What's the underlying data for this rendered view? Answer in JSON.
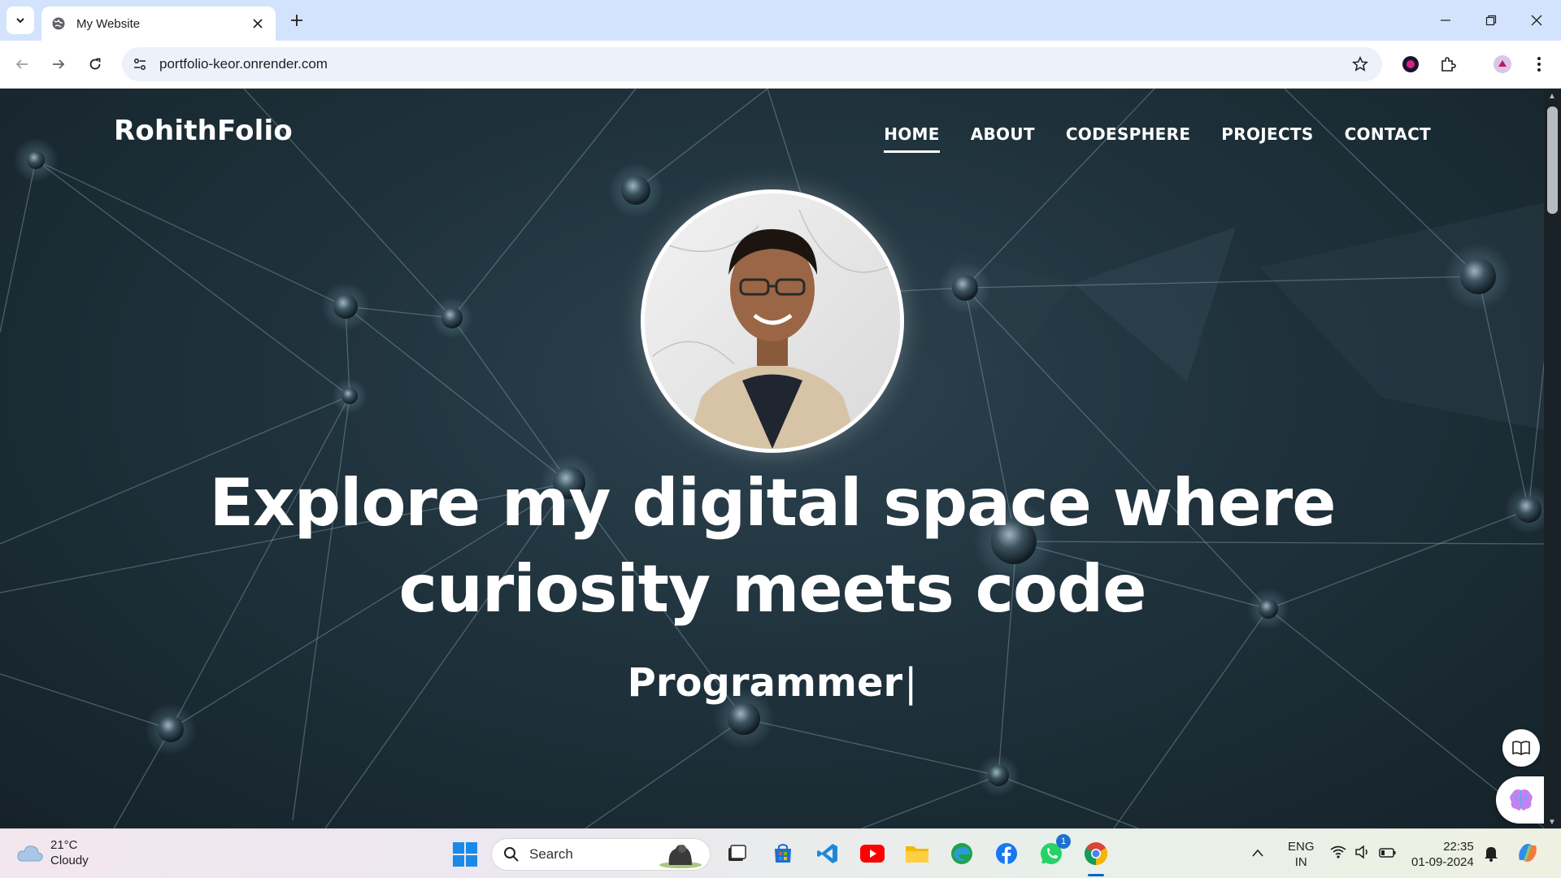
{
  "browser": {
    "tab_title": "My Website",
    "url": "portfolio-keor.onrender.com"
  },
  "site": {
    "logo": "RohithFolio",
    "nav": [
      {
        "label": "HOME",
        "active": true
      },
      {
        "label": "ABOUT",
        "active": false
      },
      {
        "label": "CODESPHERE",
        "active": false
      },
      {
        "label": "PROJECTS",
        "active": false
      },
      {
        "label": "CONTACT",
        "active": false
      }
    ],
    "headline_line1": "Explore my digital space where",
    "headline_line2": "curiosity meets code",
    "typed_text": "Programmer",
    "typed_cursor": "|"
  },
  "taskbar": {
    "weather_temp": "21°C",
    "weather_desc": "Cloudy",
    "search_label": "Search",
    "lang_line1": "ENG",
    "lang_line2": "IN",
    "time": "22:35",
    "date": "01-09-2024",
    "whatsapp_badge": "1"
  },
  "colors": {
    "tab_strip": "#d3e3fd",
    "omnibox": "#edf2fa",
    "page_bg": "#1f323c",
    "nav_text": "#ffffff"
  }
}
